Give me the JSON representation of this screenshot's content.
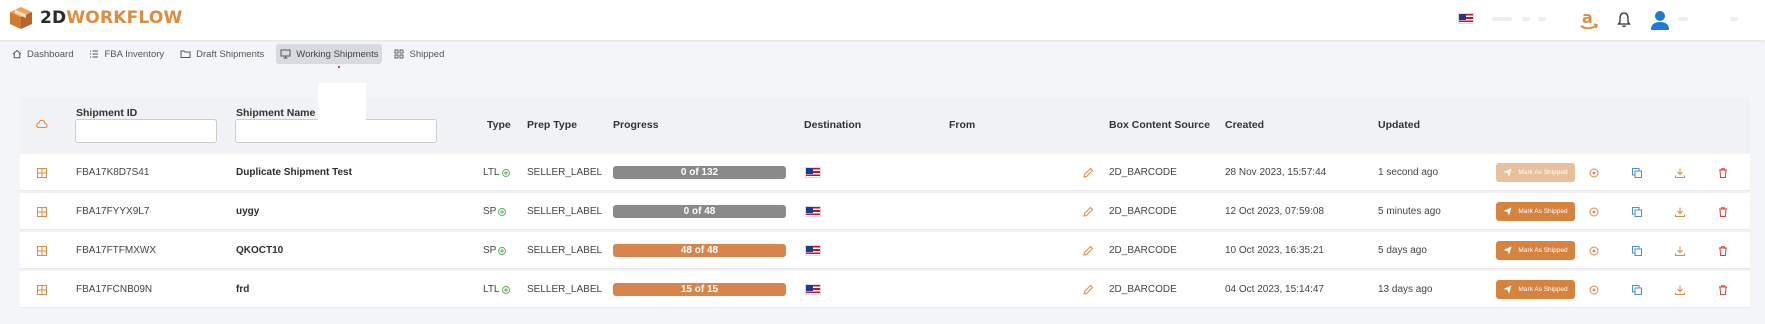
{
  "brand": {
    "part1": "2D",
    "part2": "WORKFLOW",
    "color_dark": "#2b2b2b",
    "color_orange": "#e08b3e"
  },
  "header_icons": [
    "us-flag-icon",
    "amazon-icon",
    "bell-icon",
    "user-icon"
  ],
  "nav": [
    {
      "label": "Dashboard",
      "icon": "home-icon",
      "active": false
    },
    {
      "label": "FBA Inventory",
      "icon": "list-icon",
      "active": false
    },
    {
      "label": "Draft Shipments",
      "icon": "folder-icon",
      "active": false
    },
    {
      "label": "Working Shipments",
      "icon": "monitor-icon",
      "active": true
    },
    {
      "label": "Shipped",
      "icon": "grid-icon",
      "active": false
    }
  ],
  "table": {
    "headers": {
      "shipment_id": "Shipment ID",
      "shipment_name": "Shipment Name",
      "type": "Type",
      "prep_type": "Prep Type",
      "progress": "Progress",
      "destination": "Destination",
      "from": "From",
      "box_content_source": "Box Content Source",
      "created": "Created",
      "updated": "Updated"
    },
    "filters": {
      "shipment_id_value": "",
      "shipment_name_value": ""
    },
    "mark_label": "Mark As Shipped",
    "rows": [
      {
        "id": "FBA17K8D7S41",
        "name": "Duplicate Shipment Test",
        "type": "LTL",
        "prep": "SELLER_LABEL",
        "progress_text": "0 of 132",
        "progress_done": 0,
        "progress_total": 132,
        "box_source": "2D_BARCODE",
        "created": "28 Nov 2023, 15:57:44",
        "updated": "1 second ago",
        "mark_enabled": false
      },
      {
        "id": "FBA17FYYX9L7",
        "name": "uygy",
        "type": "SP",
        "prep": "SELLER_LABEL",
        "progress_text": "0 of 48",
        "progress_done": 0,
        "progress_total": 48,
        "box_source": "2D_BARCODE",
        "created": "12 Oct 2023, 07:59:08",
        "updated": "5 minutes ago",
        "mark_enabled": true
      },
      {
        "id": "FBA17FTFMXWX",
        "name": "QKOCT10",
        "type": "SP",
        "prep": "SELLER_LABEL",
        "progress_text": "48 of 48",
        "progress_done": 48,
        "progress_total": 48,
        "box_source": "2D_BARCODE",
        "created": "10 Oct 2023, 16:35:21",
        "updated": "5 days ago",
        "mark_enabled": true
      },
      {
        "id": "FBA17FCNB09N",
        "name": "frd",
        "type": "LTL",
        "prep": "SELLER_LABEL",
        "progress_text": "15 of 15",
        "progress_done": 15,
        "progress_total": 15,
        "box_source": "2D_BARCODE",
        "created": "04 Oct 2023, 15:14:47",
        "updated": "13 days ago",
        "mark_enabled": true
      }
    ]
  },
  "colors": {
    "accent": "#d68340",
    "accent_disabled": "#e8c09a",
    "progress_gray": "#8a8a8a",
    "progress_orange": "#d7854a",
    "plus_green": "#4caf50",
    "delete_red": "#e53935",
    "icon_blue": "#4a90d9"
  }
}
